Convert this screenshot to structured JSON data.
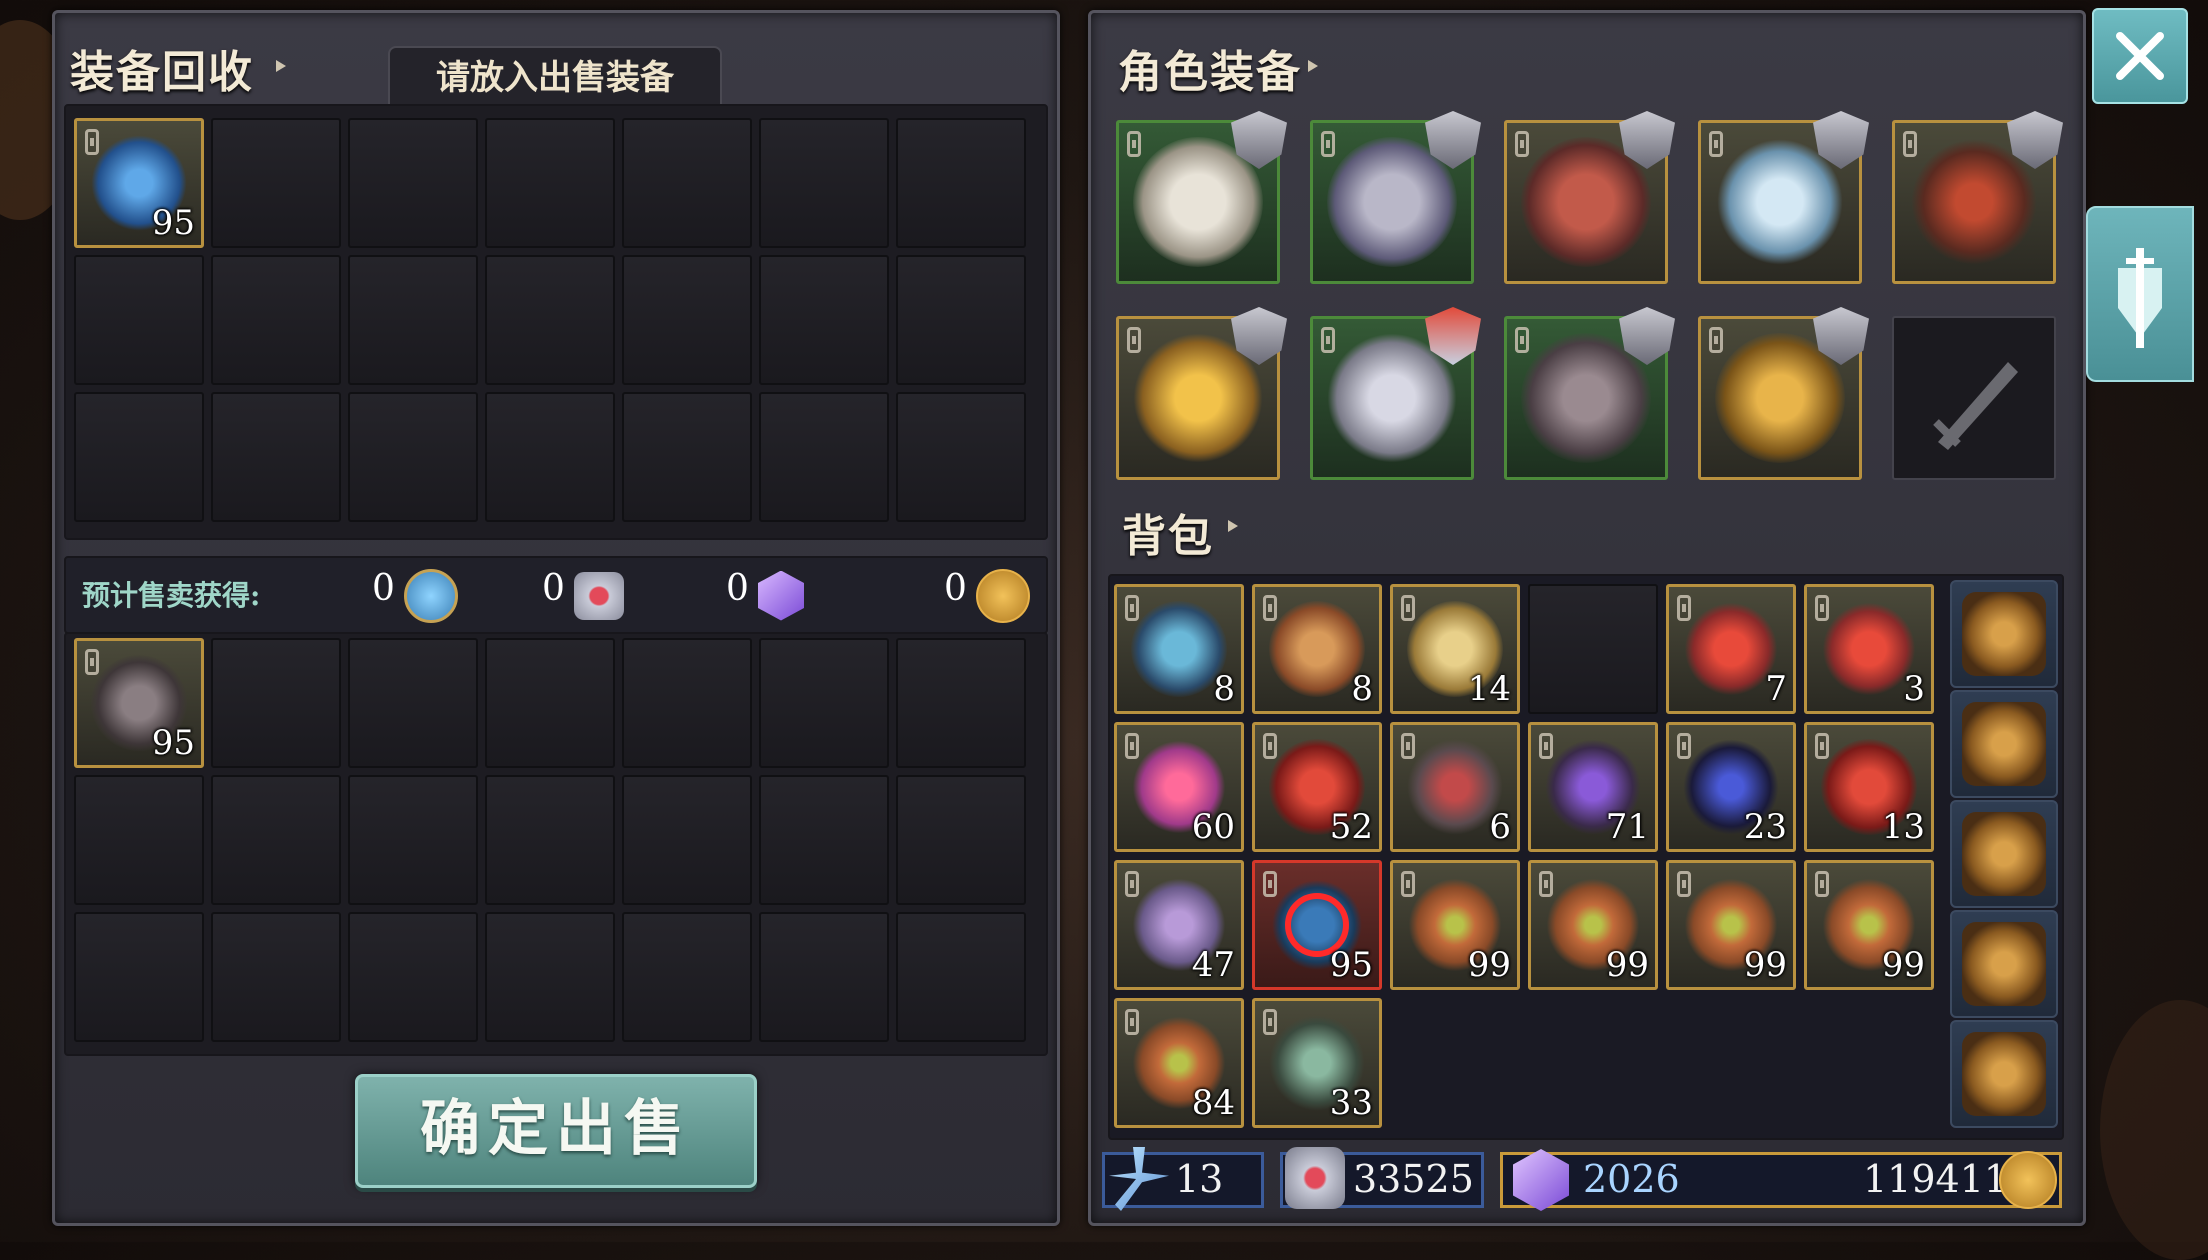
{
  "recycle": {
    "title": "装备回收",
    "tab_label": "请放入出售装备",
    "input_slot": {
      "count": "95"
    },
    "estimate_label": "预计售卖获得:",
    "estimate_values": [
      "0",
      "0",
      "0",
      "0"
    ],
    "output_slot": {
      "count": "95"
    },
    "confirm_label": "确定出售"
  },
  "equipment": {
    "title": "角色装备",
    "slots": [
      {
        "name": "helmet",
        "icon": "helmet-icon"
      },
      {
        "name": "chest",
        "icon": "chest-armor-icon"
      },
      {
        "name": "cloak",
        "icon": "cloak-icon"
      },
      {
        "name": "ring",
        "icon": "ring-icon"
      },
      {
        "name": "staff",
        "icon": "staff-icon"
      },
      {
        "name": "amulet",
        "icon": "amulet-icon"
      },
      {
        "name": "gauntlet",
        "icon": "gauntlet-icon"
      },
      {
        "name": "boots",
        "icon": "boots-icon"
      },
      {
        "name": "ring2",
        "icon": "golden-ring-icon"
      },
      {
        "name": "weapon",
        "icon": "sword-icon"
      }
    ]
  },
  "backpack": {
    "title": "背包",
    "items": [
      {
        "count": "8",
        "icon": "blue-map-icon"
      },
      {
        "count": "8",
        "icon": "red-scroll-icon"
      },
      {
        "count": "14",
        "icon": "yellow-scroll-icon"
      },
      {
        "count": "",
        "icon": ""
      },
      {
        "count": "7",
        "icon": "red-potion-icon"
      },
      {
        "count": "3",
        "icon": "red-potion-icon"
      },
      {
        "count": "60",
        "icon": "pink-gem-icon"
      },
      {
        "count": "52",
        "icon": "red-crystal-icon"
      },
      {
        "count": "6",
        "icon": "red-ore-icon"
      },
      {
        "count": "71",
        "icon": "purple-ore-icon"
      },
      {
        "count": "23",
        "icon": "dark-ingot-icon"
      },
      {
        "count": "13",
        "icon": "red-crystal-icon"
      },
      {
        "count": "47",
        "icon": "purple-card-icon"
      },
      {
        "count": "95",
        "icon": "blue-orb-icon"
      },
      {
        "count": "99",
        "icon": "spiral-rune-icon"
      },
      {
        "count": "99",
        "icon": "spiral-rune-icon"
      },
      {
        "count": "99",
        "icon": "spiral-rune-icon"
      },
      {
        "count": "99",
        "icon": "spiral-rune-icon"
      },
      {
        "count": "84",
        "icon": "spiral-rune-icon"
      },
      {
        "count": "33",
        "icon": "crown-ore-icon"
      }
    ],
    "bag_icons": [
      "bag-icon",
      "bag-icon",
      "backpack-icon",
      "leather-bag-icon",
      "pouch-icon"
    ]
  },
  "currency": {
    "magic_dust": "13",
    "hearts": "33525",
    "gems": "2026",
    "gold": "119411"
  },
  "colors": {
    "accent_teal": "#5aa8ae",
    "slot_gold": "#b8913f",
    "slot_green": "#4c8a3a",
    "slot_selected": "#d5382a"
  }
}
